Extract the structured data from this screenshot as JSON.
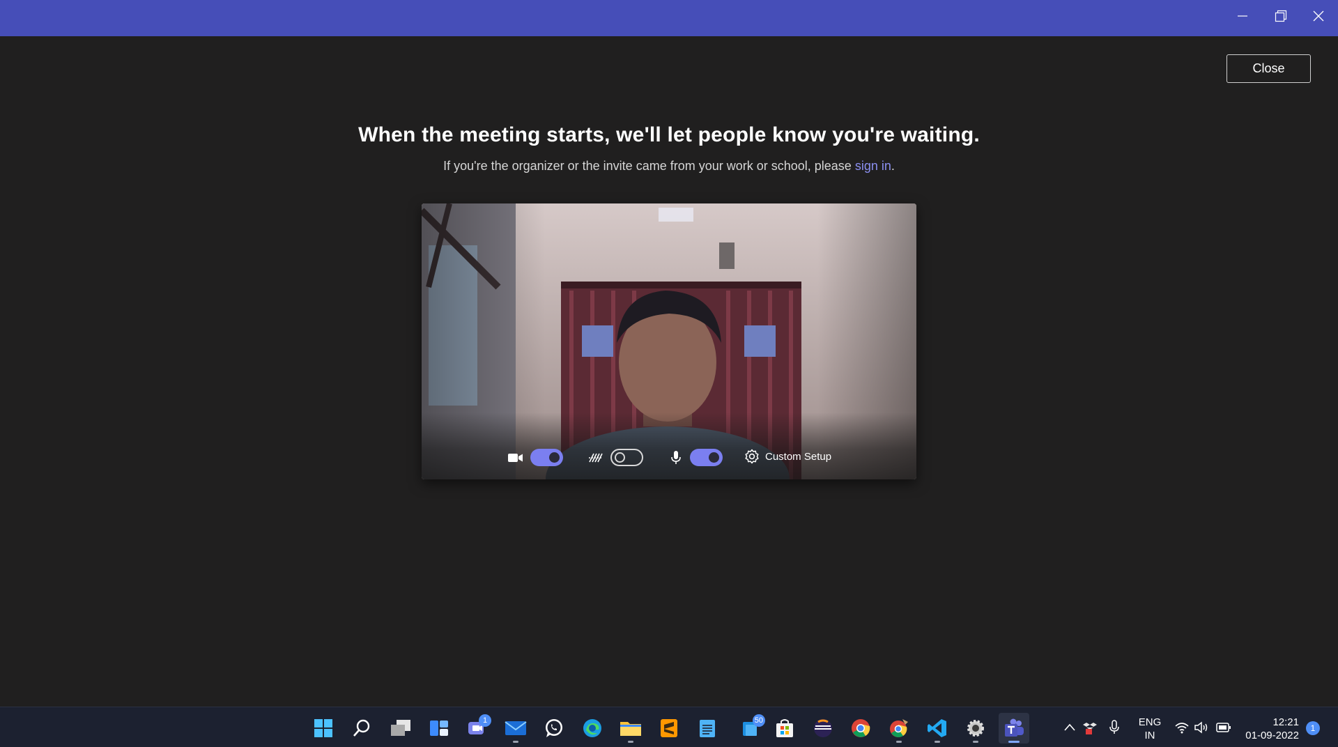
{
  "window": {
    "minimize_label": "Minimize",
    "maximize_label": "Restore",
    "close_label": "Close window"
  },
  "main": {
    "close_button": "Close",
    "heading": "When the meeting starts, we'll let people know you're waiting.",
    "subline_prefix": "If you're the organizer or the invite came from your work or school, please ",
    "subline_link": "sign in",
    "subline_suffix": "."
  },
  "preview": {
    "camera": {
      "icon": "video-camera-icon",
      "on": true
    },
    "background_blur": {
      "icon": "background-effects-icon",
      "on": false
    },
    "microphone": {
      "icon": "microphone-icon",
      "on": true
    },
    "custom_setup": {
      "icon": "gear-icon",
      "label": "Custom Setup"
    }
  },
  "taskbar": {
    "apps": [
      {
        "name": "start",
        "icon": "windows-start-icon"
      },
      {
        "name": "search",
        "icon": "search-icon"
      },
      {
        "name": "task-view",
        "icon": "task-view-icon"
      },
      {
        "name": "widgets",
        "icon": "widgets-icon"
      },
      {
        "name": "teams-chat",
        "icon": "chat-icon",
        "badge": "1"
      },
      {
        "name": "mail",
        "icon": "mail-icon"
      },
      {
        "name": "whatsapp",
        "icon": "whatsapp-icon"
      },
      {
        "name": "edge",
        "icon": "edge-icon"
      },
      {
        "name": "file-explorer",
        "icon": "folder-icon"
      },
      {
        "name": "sublime-text",
        "icon": "sublime-icon"
      },
      {
        "name": "notepad",
        "icon": "notepad-icon"
      },
      {
        "name": "todo",
        "icon": "todo-icon",
        "badge": "50"
      },
      {
        "name": "store",
        "icon": "store-icon"
      },
      {
        "name": "eclipse",
        "icon": "eclipse-icon"
      },
      {
        "name": "chrome",
        "icon": "chrome-icon"
      },
      {
        "name": "chrome-dev",
        "icon": "chrome-alt-icon"
      },
      {
        "name": "vscode",
        "icon": "vscode-icon"
      },
      {
        "name": "settings",
        "icon": "settings-icon"
      },
      {
        "name": "teams",
        "icon": "teams-icon",
        "active": true
      }
    ],
    "tray": {
      "language_line1": "ENG",
      "language_line2": "IN",
      "time": "12:21",
      "date": "01-09-2022",
      "notifications": "1"
    }
  }
}
